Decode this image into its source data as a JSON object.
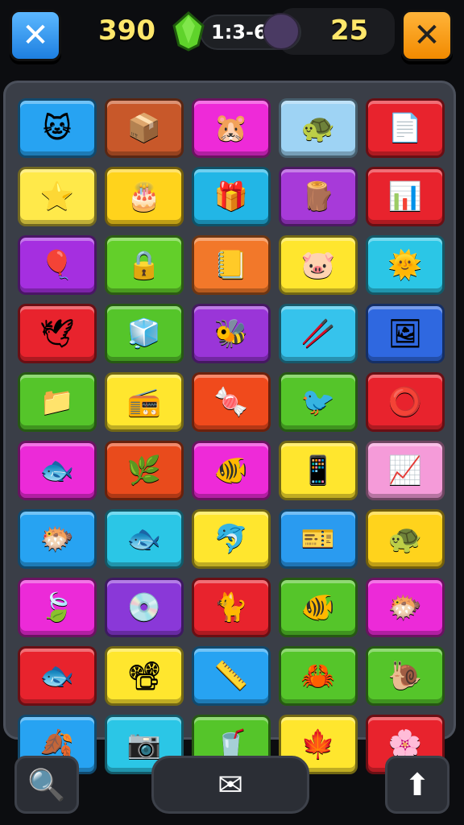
{
  "hud": {
    "close_left_glyph": "✕",
    "score": "390",
    "gem_icon": "green-gem-icon",
    "timer": "1:3-6",
    "counter": "25",
    "close_right_glyph": "✕"
  },
  "bottom_bar": {
    "search_icon": "🔍",
    "mail_icon": "✉",
    "upload_icon": "⬆"
  },
  "tiles": [
    {
      "icon": "cat-face-icon",
      "glyph": "🐱",
      "color": "#27a3f2"
    },
    {
      "icon": "box-icon",
      "glyph": "📦",
      "color": "#c8582a"
    },
    {
      "icon": "hamster-icon",
      "glyph": "🐹",
      "color": "#ee2ad8"
    },
    {
      "icon": "turtle-icon",
      "glyph": "🐢",
      "color": "#9ed3f4"
    },
    {
      "icon": "document-icon",
      "glyph": "📄",
      "color": "#e8232d"
    },
    {
      "icon": "star-card-icon",
      "glyph": "⭐",
      "color": "#ffe94a"
    },
    {
      "icon": "cake-icon",
      "glyph": "🎂",
      "color": "#ffd31c"
    },
    {
      "icon": "gift-box-icon",
      "glyph": "🎁",
      "color": "#22b6e6"
    },
    {
      "icon": "fire-log-icon",
      "glyph": "🪵",
      "color": "#a73ad9"
    },
    {
      "icon": "bar-chart-icon",
      "glyph": "📊",
      "color": "#e8232d"
    },
    {
      "icon": "balloon-icon",
      "glyph": "🎈",
      "color": "#a52fe0"
    },
    {
      "icon": "padlock-icon",
      "glyph": "🔒",
      "color": "#63cf2a"
    },
    {
      "icon": "notebook-icon",
      "glyph": "📒",
      "color": "#f2782a"
    },
    {
      "icon": "pig-icon",
      "glyph": "🐷",
      "color": "#ffe62e"
    },
    {
      "icon": "sun-gear-icon",
      "glyph": "🌞",
      "color": "#2bc6e6"
    },
    {
      "icon": "white-bird-icon",
      "glyph": "🕊",
      "color": "#e8232d"
    },
    {
      "icon": "cube-icon",
      "glyph": "🧊",
      "color": "#55c52a"
    },
    {
      "icon": "bee-icon",
      "glyph": "🐝",
      "color": "#9a35d8"
    },
    {
      "icon": "drumsticks-icon",
      "glyph": "🥢",
      "color": "#36c3ec"
    },
    {
      "icon": "picture-frame-icon",
      "glyph": "🖼",
      "color": "#2f68e0"
    },
    {
      "icon": "folder-sign-icon",
      "glyph": "📁",
      "color": "#55c52a"
    },
    {
      "icon": "radio-icon",
      "glyph": "📻",
      "color": "#ffe62e"
    },
    {
      "icon": "candy-wrapper-icon",
      "glyph": "🍬",
      "color": "#f04a1c"
    },
    {
      "icon": "purple-bird-icon",
      "glyph": "🐦",
      "color": "#55c52a"
    },
    {
      "icon": "ring-target-icon",
      "glyph": "⭕",
      "color": "#e8232d"
    },
    {
      "icon": "blue-fish-icon",
      "glyph": "🐟",
      "color": "#ec2ad8"
    },
    {
      "icon": "leaf-branch-icon",
      "glyph": "🌿",
      "color": "#e94b1c"
    },
    {
      "icon": "pink-fish-icon",
      "glyph": "🐠",
      "color": "#ee2ad8"
    },
    {
      "icon": "tablet-icon",
      "glyph": "📱",
      "color": "#ffe62e"
    },
    {
      "icon": "color-bars-icon",
      "glyph": "📈",
      "color": "#f59bd9"
    },
    {
      "icon": "orange-fish-icon",
      "glyph": "🐡",
      "color": "#27a3f2"
    },
    {
      "icon": "pink-cat-fish-icon",
      "glyph": "🐟",
      "color": "#2bc6e6"
    },
    {
      "icon": "blue-fish-icon",
      "glyph": "🐬",
      "color": "#ffe62e"
    },
    {
      "icon": "ticket-icon",
      "glyph": "🎫",
      "color": "#2a9bf0"
    },
    {
      "icon": "green-turtle-icon",
      "glyph": "🐢",
      "color": "#ffd31c"
    },
    {
      "icon": "green-leaf-icon",
      "glyph": "🍃",
      "color": "#ec2ad8"
    },
    {
      "icon": "pink-disc-icon",
      "glyph": "💿",
      "color": "#8a38d8"
    },
    {
      "icon": "orange-cat-icon",
      "glyph": "🐈",
      "color": "#e8232d"
    },
    {
      "icon": "goldfish-icon",
      "glyph": "🐠",
      "color": "#55c52a"
    },
    {
      "icon": "pink-blob-fish-icon",
      "glyph": "🐡",
      "color": "#ec2ad8"
    },
    {
      "icon": "red-fish-icon",
      "glyph": "🐟",
      "color": "#e8232d"
    },
    {
      "icon": "projector-icon",
      "glyph": "📽",
      "color": "#ffe62e"
    },
    {
      "icon": "ruler-icon",
      "glyph": "📏",
      "color": "#27a3f2"
    },
    {
      "icon": "crab-icon",
      "glyph": "🦀",
      "color": "#55c52a"
    },
    {
      "icon": "snail-icon",
      "glyph": "🐌",
      "color": "#55c52a"
    },
    {
      "icon": "yellow-leaf-icon",
      "glyph": "🍂",
      "color": "#27a3f2"
    },
    {
      "icon": "camera-icon",
      "glyph": "📷",
      "color": "#2bc6e6"
    },
    {
      "icon": "cup-icon",
      "glyph": "🥤",
      "color": "#55c52a"
    },
    {
      "icon": "maple-leaf-icon",
      "glyph": "🍁",
      "color": "#ffe62e"
    },
    {
      "icon": "pink-splash-icon",
      "glyph": "🌸",
      "color": "#e8232d"
    }
  ]
}
